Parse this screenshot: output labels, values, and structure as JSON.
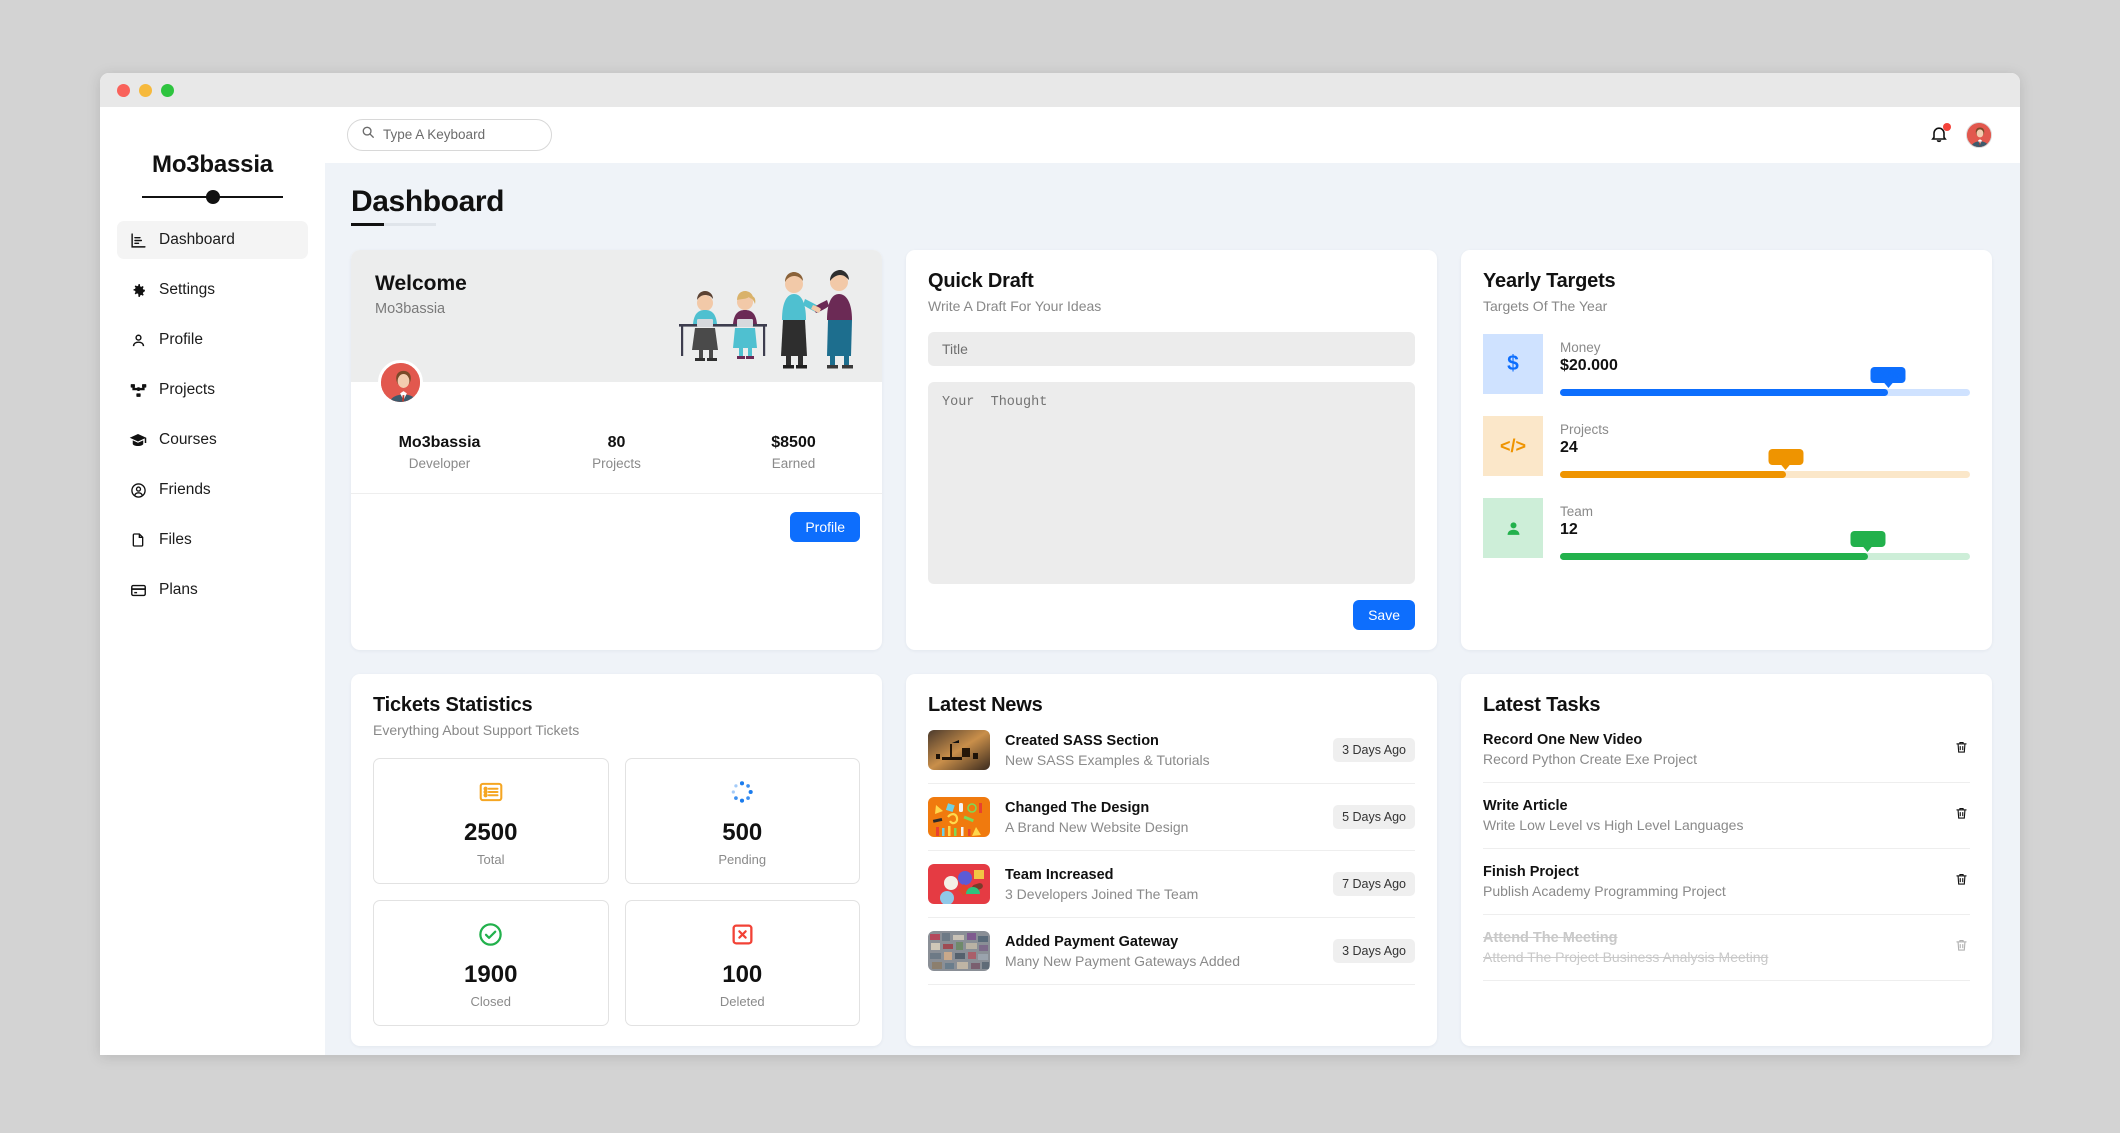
{
  "window": {
    "traffic_lights": [
      "close",
      "minimize",
      "maximize"
    ]
  },
  "sidebar": {
    "brand": "Mo3bassia",
    "items": [
      {
        "label": "Dashboard",
        "icon": "chart-bars-icon",
        "active": true
      },
      {
        "label": "Settings",
        "icon": "gear-icon",
        "active": false
      },
      {
        "label": "Profile",
        "icon": "user-icon",
        "active": false
      },
      {
        "label": "Projects",
        "icon": "sitemap-icon",
        "active": false
      },
      {
        "label": "Courses",
        "icon": "graduation-cap-icon",
        "active": false
      },
      {
        "label": "Friends",
        "icon": "user-circle-icon",
        "active": false
      },
      {
        "label": "Files",
        "icon": "file-icon",
        "active": false
      },
      {
        "label": "Plans",
        "icon": "credit-card-icon",
        "active": false
      }
    ]
  },
  "topbar": {
    "search": {
      "placeholder": "Type A Keyboard",
      "value": "",
      "icon": "search-icon"
    },
    "bell": {
      "icon": "bell-icon",
      "has_notification": true
    },
    "avatar": {
      "icon": "avatar"
    }
  },
  "page": {
    "title": "Dashboard"
  },
  "welcome": {
    "heading": "Welcome",
    "subheading": "Mo3bassia",
    "stats": [
      {
        "value": "Mo3bassia",
        "label": "Developer"
      },
      {
        "value": "80",
        "label": "Projects"
      },
      {
        "value": "$8500",
        "label": "Earned"
      }
    ],
    "button": "Profile"
  },
  "quick_draft": {
    "title": "Quick Draft",
    "subtitle": "Write A Draft For Your Ideas",
    "title_placeholder": "Title",
    "title_value": "",
    "thought_placeholder": "Your  Thought",
    "thought_value": "",
    "save_label": "Save"
  },
  "yearly_targets": {
    "title": "Yearly Targets",
    "subtitle": "Targets Of The Year",
    "items": [
      {
        "icon": "dollar-icon",
        "glyph": "$",
        "label": "Money",
        "value": "$20.000",
        "percent": "80%",
        "percent_num": 80,
        "color": "#0d6efd",
        "track": "#cfe2ff",
        "tile_bg": "#cfe2ff"
      },
      {
        "icon": "code-icon",
        "glyph": "</>",
        "label": "Projects",
        "value": "24",
        "percent": "55%",
        "percent_num": 55,
        "color": "#ef9400",
        "track": "#fbe7c9",
        "tile_bg": "#fbe7c9"
      },
      {
        "icon": "person-icon",
        "glyph": "",
        "label": "Team",
        "value": "12",
        "percent": "75%",
        "percent_num": 75,
        "color": "#22b14c",
        "track": "#cdeed8",
        "tile_bg": "#cdeed8"
      }
    ]
  },
  "tickets": {
    "title": "Tickets Statistics",
    "subtitle": "Everything About Support Tickets",
    "boxes": [
      {
        "icon": "list-icon",
        "value": "2500",
        "label": "Total",
        "color": "#f5a623"
      },
      {
        "icon": "spinner-dots-icon",
        "value": "500",
        "label": "Pending",
        "color": "#1b7ced"
      },
      {
        "icon": "check-circle-icon",
        "value": "1900",
        "label": "Closed",
        "color": "#22b14c"
      },
      {
        "icon": "x-square-icon",
        "value": "100",
        "label": "Deleted",
        "color": "#f24236"
      }
    ]
  },
  "latest_news": {
    "title": "Latest News",
    "items": [
      {
        "title": "Created SASS Section",
        "desc": "New SASS Examples & Tutorials",
        "time": "3 Days Ago",
        "thumb": "desk-lamp-photo"
      },
      {
        "title": "Changed The Design",
        "desc": "A Brand New Website Design",
        "time": "5 Days Ago",
        "thumb": "orange-stationery-photo"
      },
      {
        "title": "Team Increased",
        "desc": "3 Developers Joined The Team",
        "time": "7 Days Ago",
        "thumb": "red-confetti-photo"
      },
      {
        "title": "Added Payment Gateway",
        "desc": "Many New Payment Gateways Added",
        "time": "3 Days Ago",
        "thumb": "electronics-scrap-photo"
      }
    ]
  },
  "latest_tasks": {
    "title": "Latest Tasks",
    "items": [
      {
        "title": "Record One New Video",
        "desc": "Record Python Create Exe Project",
        "done": false
      },
      {
        "title": "Write Article",
        "desc": "Write Low Level vs High Level Languages",
        "done": false
      },
      {
        "title": "Finish Project",
        "desc": "Publish Academy Programming Project",
        "done": false
      },
      {
        "title": "Attend The Meeting",
        "desc": "Attend The Project Business Analysis Meeting",
        "done": true
      }
    ]
  }
}
